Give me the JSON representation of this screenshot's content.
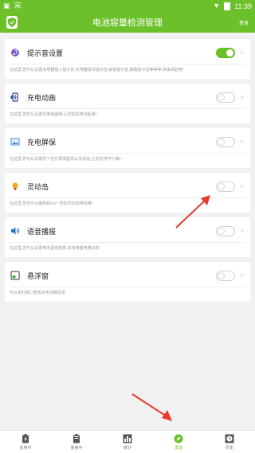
{
  "status_bar": {
    "time": "11:39",
    "left_label": "宋"
  },
  "header": {
    "title": "电池容量检测管理",
    "action": "登录"
  },
  "cards": [
    {
      "title": "提示音设置",
      "icon": "music-note-icon",
      "toggle_on": true,
      "desc": "在这里,您可以设置充电器插入提示音,充电器拔出提示音,解锁提示音,鼓醒提示音等等等,快来体验吧!"
    },
    {
      "title": "充电动画",
      "icon": "phone-charging-icon",
      "toggle_on": false,
      "desc": "在这里,您可以设置充电动画哦,让您的充电动起来!"
    },
    {
      "title": "充电屏保",
      "icon": "image-icon",
      "toggle_on": false,
      "desc": "在这里,您可以设置您个性化屏保壁纸以及动画,让您充电开心嗨~"
    },
    {
      "title": "灵动岛",
      "icon": "bulb-icon",
      "toggle_on": false,
      "desc": "在这里,您也可以拥有和ios一样的灵动岛特效哦~"
    },
    {
      "title": "语音播报",
      "icon": "speaker-icon",
      "toggle_on": false,
      "desc": "在这里,您可以设置电池语音播报,实时掌握电量动态"
    },
    {
      "title": "悬浮窗",
      "icon": "floating-window-icon",
      "toggle_on": false,
      "desc": "可以实时窗口查看充电详细信息"
    }
  ],
  "tabs": [
    {
      "label": "充电中",
      "icon": "battery-icon"
    },
    {
      "label": "使用中",
      "icon": "battery-half-icon"
    },
    {
      "label": "统计",
      "icon": "bar-chart-icon"
    },
    {
      "label": "发现",
      "icon": "compass-icon",
      "active": true
    },
    {
      "label": "历史",
      "icon": "clock-icon"
    }
  ],
  "colors": {
    "accent": "#6cc02a",
    "arrow": "#e53b2c"
  }
}
